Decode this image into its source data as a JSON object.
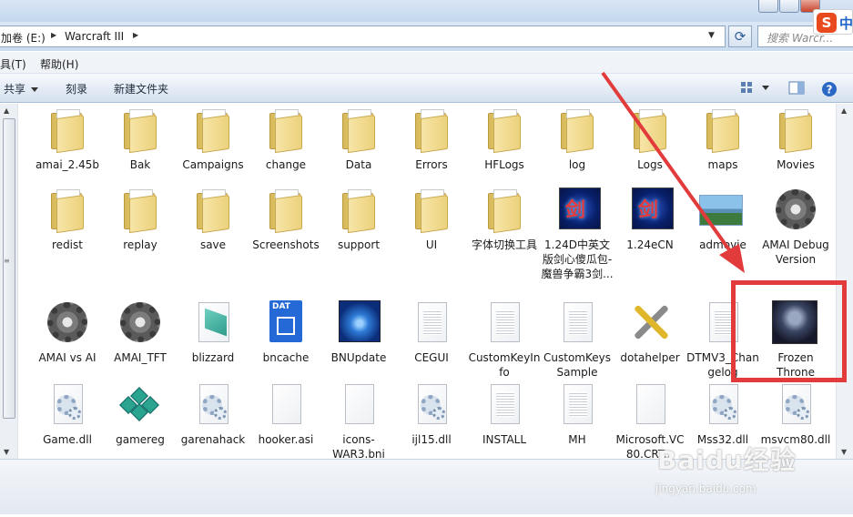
{
  "address_bar": {
    "crumbs": [
      "加卷 (E:)",
      "Warcraft III"
    ],
    "search_placeholder": "搜索 Warcr..."
  },
  "ime": {
    "logo": "S",
    "lang": "中"
  },
  "menu": [
    "具(T)",
    "帮助(H)"
  ],
  "toolbar": {
    "share": "共享",
    "burn": "刻录",
    "new_folder": "新建文件夹"
  },
  "items": [
    {
      "label": "amai_2.45b",
      "icon": "folder-icon"
    },
    {
      "label": "Bak",
      "icon": "folder-icon"
    },
    {
      "label": "Campaigns",
      "icon": "folder-icon"
    },
    {
      "label": "change",
      "icon": "folder-icon"
    },
    {
      "label": "Data",
      "icon": "folder-icon"
    },
    {
      "label": "Errors",
      "icon": "folder-icon"
    },
    {
      "label": "HFLogs",
      "icon": "folder-icon"
    },
    {
      "label": "log",
      "icon": "folder-icon"
    },
    {
      "label": "Logs",
      "icon": "folder-icon"
    },
    {
      "label": "maps",
      "icon": "folder-icon"
    },
    {
      "label": "Movies",
      "icon": "folder-icon"
    },
    {
      "label": "redist",
      "icon": "folder-icon"
    },
    {
      "label": "replay",
      "icon": "folder-icon"
    },
    {
      "label": "save",
      "icon": "folder-icon"
    },
    {
      "label": "Screenshots",
      "icon": "folder-icon"
    },
    {
      "label": "support",
      "icon": "folder-icon"
    },
    {
      "label": "UI",
      "icon": "folder-icon"
    },
    {
      "label": "字体切换工具",
      "icon": "folder-icon"
    },
    {
      "label": "1.24D中英文版剑心傻瓜包-魔兽争霸3剑...",
      "icon": "game-exe-icon"
    },
    {
      "label": "1.24eCN",
      "icon": "game-exe-icon"
    },
    {
      "label": "admovie",
      "icon": "image-file-icon"
    },
    {
      "label": "AMAI Debug Version",
      "icon": "gear-exe-icon"
    },
    {
      "label": "AMAI vs AI",
      "icon": "gear-exe-icon"
    },
    {
      "label": "AMAI_TFT",
      "icon": "gear-exe-icon"
    },
    {
      "label": "blizzard",
      "icon": "blizzard-file-icon"
    },
    {
      "label": "bncache",
      "icon": "dat-file-icon"
    },
    {
      "label": "BNUpdate",
      "icon": "bnupdate-exe-icon"
    },
    {
      "label": "CEGUI",
      "icon": "document-icon"
    },
    {
      "label": "CustomKeyInfo",
      "icon": "document-icon"
    },
    {
      "label": "CustomKeysSample",
      "icon": "document-icon"
    },
    {
      "label": "dotahelper",
      "icon": "tools-exe-icon"
    },
    {
      "label": "DTMV3_Changelog",
      "icon": "document-icon"
    },
    {
      "label": "Frozen Throne",
      "icon": "frozen-throne-exe-icon"
    },
    {
      "label": "Game.dll",
      "icon": "dll-icon"
    },
    {
      "label": "gamereg",
      "icon": "registry-icon"
    },
    {
      "label": "garenahack",
      "icon": "dll-icon"
    },
    {
      "label": "hooker.asi",
      "icon": "blank-file-icon"
    },
    {
      "label": "icons-WAR3.bni",
      "icon": "blank-file-icon"
    },
    {
      "label": "ijl15.dll",
      "icon": "dll-icon"
    },
    {
      "label": "INSTALL",
      "icon": "document-icon"
    },
    {
      "label": "MH",
      "icon": "document-icon"
    },
    {
      "label": "Microsoft.VC80.CRT...",
      "icon": "blank-file-icon"
    },
    {
      "label": "Mss32.dll",
      "icon": "dll-icon"
    },
    {
      "label": "msvcm80.dll",
      "icon": "dll-icon"
    }
  ],
  "annotation": {
    "highlight_color": "#e33b3b"
  },
  "watermark": {
    "brand": "Baidu经验",
    "url": "jingyan.baidu.com"
  }
}
